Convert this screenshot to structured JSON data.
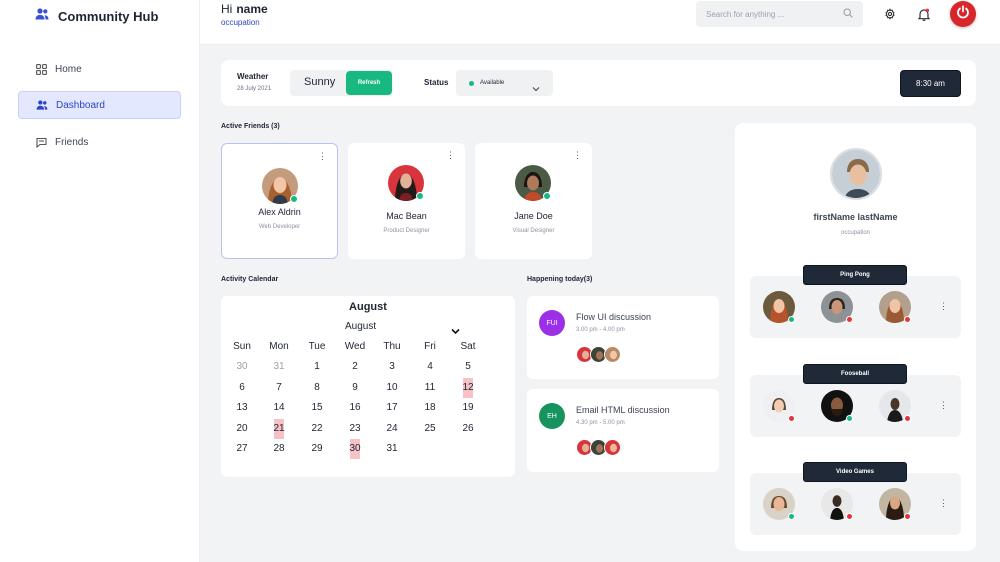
{
  "app": {
    "brand_name": "Community Hub"
  },
  "sidebar": {
    "items": [
      {
        "label": "Home",
        "icon": "grid-icon"
      },
      {
        "label": "Dashboard",
        "icon": "users-icon",
        "active": true
      },
      {
        "label": "Friends",
        "icon": "chat-icon"
      }
    ]
  },
  "header": {
    "greeting": "Hi",
    "name": "name",
    "occupation": "occupation",
    "search_placeholder": "Search for anything ..."
  },
  "weather": {
    "label": "Weather",
    "date": "28 July 2021",
    "condition": "Sunny",
    "refresh_label": "Refresh",
    "status_label": "Status",
    "status_value": "Available",
    "time": "8:30 am"
  },
  "friends": {
    "title": "Active Friends (3)",
    "items": [
      {
        "name": "Alex Aldrin",
        "role": "Web Developer"
      },
      {
        "name": "Mac Bean",
        "role": "Product Designer"
      },
      {
        "name": "Jane Doe",
        "role": "Visual Designer"
      }
    ]
  },
  "calendar": {
    "section_title": "Activity Calendar",
    "title": "August",
    "month_select": "August",
    "weekdays": [
      "Sun",
      "Mon",
      "Tue",
      "Wed",
      "Thu",
      "Fri",
      "Sat"
    ],
    "weeks": [
      [
        "30",
        "31",
        "1",
        "2",
        "3",
        "4",
        "5"
      ],
      [
        "6",
        "7",
        "8",
        "9",
        "10",
        "11",
        "12"
      ],
      [
        "13",
        "14",
        "15",
        "16",
        "17",
        "18",
        "19"
      ],
      [
        "20",
        "21",
        "22",
        "23",
        "24",
        "25",
        "26"
      ],
      [
        "27",
        "28",
        "29",
        "30",
        "31",
        "",
        ""
      ]
    ],
    "muted_days": [
      "30",
      "31"
    ],
    "marked_days": [
      "12",
      "21",
      "30"
    ]
  },
  "happening": {
    "title": "Happening today(3)",
    "events": [
      {
        "initials": "FUI",
        "title": "Flow UI discussion",
        "time": "3.00 pm - 4.00 pm",
        "color": "#9b30e8"
      },
      {
        "initials": "EH",
        "title": "Email HTML discussion",
        "time": "4.30 pm - 5.00 pm",
        "color": "#16935e"
      }
    ]
  },
  "profile": {
    "name": "firstName lastName",
    "occupation": "occupation"
  },
  "games": [
    {
      "name": "Ping Pong",
      "statuses": [
        "online",
        "busy",
        "busy"
      ]
    },
    {
      "name": "Fooseball",
      "statuses": [
        "busy",
        "online",
        "busy"
      ]
    },
    {
      "name": "Video Games",
      "statuses": [
        "online",
        "busy",
        "busy"
      ]
    }
  ],
  "colors": {
    "accent": "#2e44c9",
    "online": "#17b980",
    "busy": "#e0353b",
    "dark": "#1f2937",
    "calendar_mark": "#f7c2c6"
  }
}
